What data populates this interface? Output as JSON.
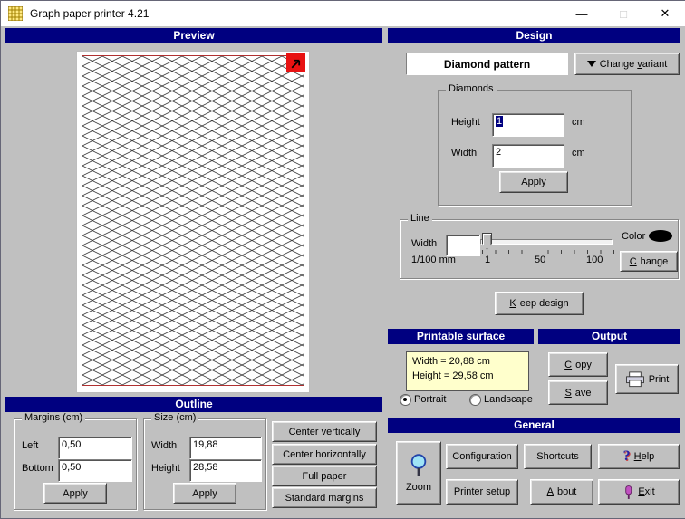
{
  "window": {
    "title": "Graph paper printer 4.21",
    "controls": {
      "minimize": "—",
      "maximize": "□",
      "close": "✕"
    }
  },
  "sections": {
    "preview": "Preview",
    "design": "Design",
    "printable_surface": "Printable surface",
    "output": "Output",
    "outline": "Outline",
    "general": "General"
  },
  "design": {
    "pattern_name": "Diamond pattern",
    "change_variant_label": "Change variant",
    "diamonds": {
      "legend": "Diamonds",
      "height_label": "Height",
      "height_value": "1",
      "height_unit": "cm",
      "width_label": "Width",
      "width_value": "2",
      "width_unit": "cm",
      "apply_label": "Apply"
    },
    "line": {
      "legend": "Line",
      "width_label": "Width",
      "width_value": "",
      "scale_unit": "1/100 mm",
      "ticks": {
        "min": "1",
        "mid": "50",
        "max": "100"
      },
      "color_label": "Color",
      "change_label": "Change"
    },
    "keep_design_label": "Keep design"
  },
  "printable_surface": {
    "width_text": "Width = 20,88 cm",
    "height_text": "Height = 29,58 cm",
    "portrait_label": "Portrait",
    "landscape_label": "Landscape"
  },
  "output": {
    "copy_label": "Copy",
    "save_label": "Save",
    "print_label": "Print"
  },
  "outline": {
    "margins": {
      "legend": "Margins (cm)",
      "left_label": "Left",
      "left_value": "0,50",
      "bottom_label": "Bottom",
      "bottom_value": "0,50",
      "apply_label": "Apply"
    },
    "size": {
      "legend": "Size (cm)",
      "width_label": "Width",
      "width_value": "19,88",
      "height_label": "Height",
      "height_value": "28,58",
      "apply_label": "Apply"
    },
    "buttons": {
      "center_vertically": "Center vertically",
      "center_horizontally": "Center horizontally",
      "full_paper": "Full paper",
      "standard_margins": "Standard margins"
    }
  },
  "general": {
    "zoom_label": "Zoom",
    "configuration_label": "Configuration",
    "shortcuts_label": "Shortcuts",
    "help_label": "Help",
    "printer_setup_label": "Printer setup",
    "about_label": "About",
    "exit_label": "Exit"
  },
  "colors": {
    "header_bg": "#000080",
    "window_bg": "#c0c0c0",
    "info_bg": "#ffffcc",
    "preview_border": "#b03030",
    "expand_icon_bg": "#e81212",
    "line_color": "#000000"
  }
}
